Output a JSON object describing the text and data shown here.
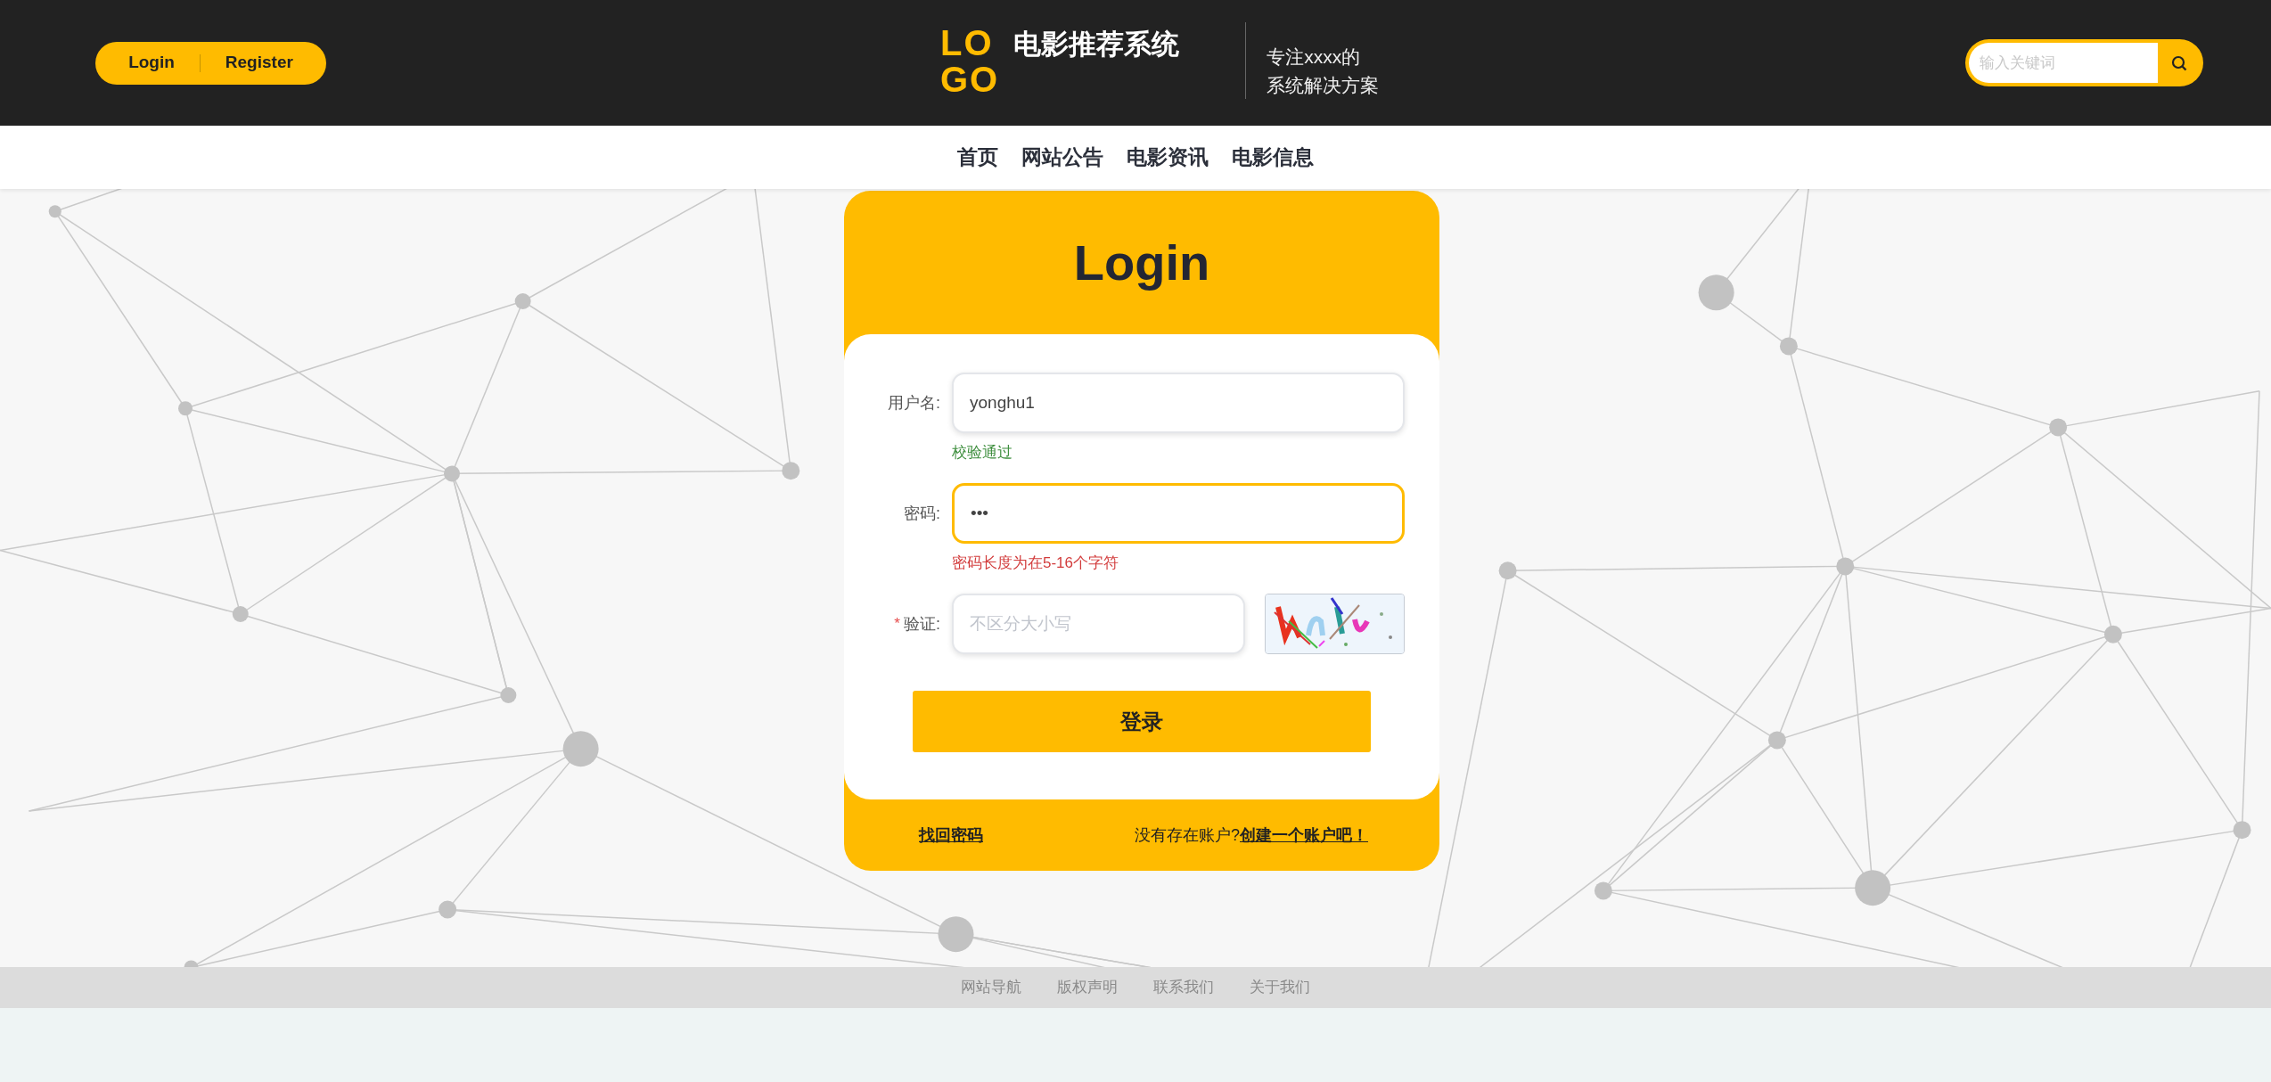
{
  "header": {
    "auth_links": [
      {
        "label": "Login"
      },
      {
        "label": "Register"
      }
    ],
    "logo": {
      "mark_lines": [
        "LO",
        "GO"
      ],
      "title": "电影推荐系统"
    },
    "slogan": [
      "专注xxxx的",
      "系统解决方案"
    ],
    "search": {
      "placeholder": "输入关键词"
    }
  },
  "nav": [
    {
      "label": "首页"
    },
    {
      "label": "网站公告"
    },
    {
      "label": "电影资讯"
    },
    {
      "label": "电影信息"
    }
  ],
  "login_form": {
    "title": "Login",
    "fields": [
      {
        "kind": "text",
        "label": "用户名:",
        "value": "yonghu1",
        "focused": false,
        "message": "校验通过",
        "valid": true
      },
      {
        "kind": "password",
        "label": "密码:",
        "value": "•••",
        "focused": true,
        "message": "密码长度为在5-16个字符",
        "valid": false
      },
      {
        "kind": "captcha",
        "required_mark": "*",
        "label": "验证:",
        "placeholder": "不区分大小写",
        "focused": false
      }
    ],
    "submit": "登录",
    "forgot_link": "找回密码",
    "signup_prompt": "没有存在账户?",
    "signup_link": "创建一个账户吧！"
  },
  "footer_links": [
    "网站导航",
    "版权声明",
    "联系我们",
    "关于我们"
  ]
}
